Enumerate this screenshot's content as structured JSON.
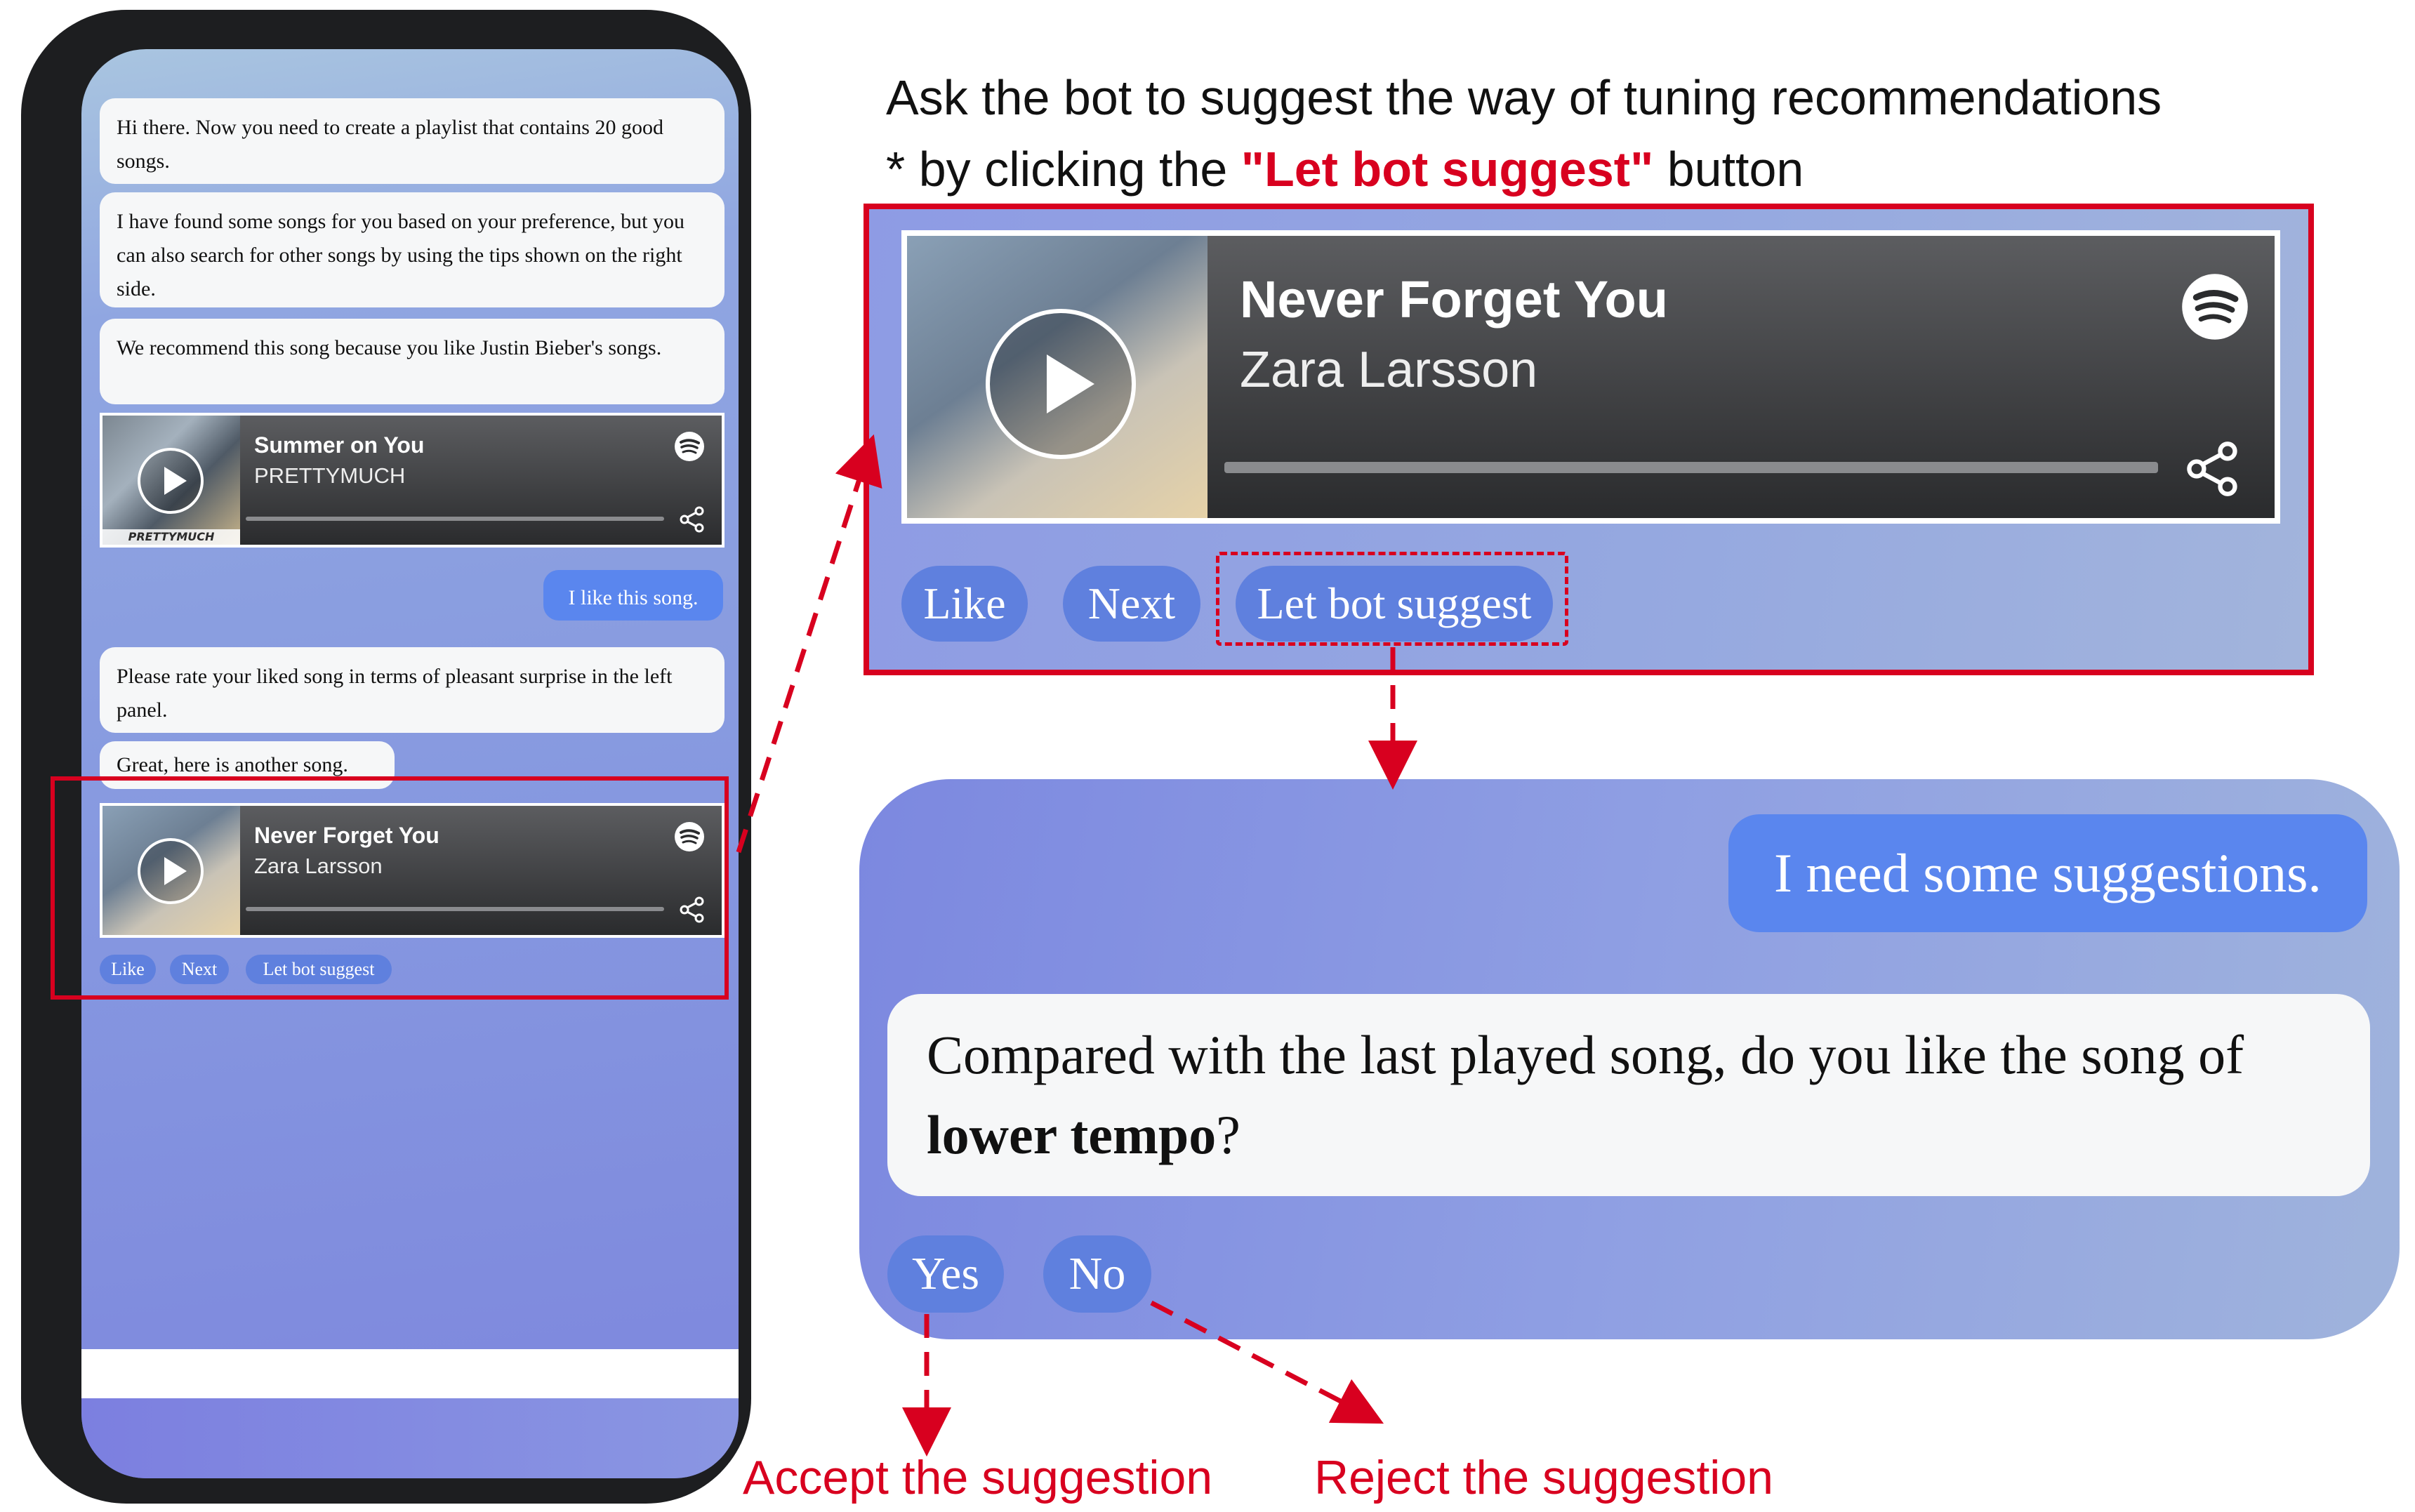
{
  "heading": {
    "line1": "Ask the bot to suggest the way of tuning recommendations",
    "line2_prefix": "* by clicking the ",
    "line2_highlight": "\"Let bot suggest\"",
    "line2_suffix": " button"
  },
  "phone": {
    "messages": [
      "Hi there. Now you need to create a playlist that contains 20 good songs.",
      "I have found some songs for you based on your preference, but you can also search for other songs by using the tips shown on the right side.",
      "We recommend this song because you like Justin Bieber's songs."
    ],
    "card1": {
      "title": "Summer on You",
      "artist": "PRETTYMUCH",
      "album_text": "PRETTYMUCH"
    },
    "user_message": "I like this song.",
    "rate_message": "Please rate your liked song in terms of pleasant surprise in the left panel.",
    "another_message": "Great, here is another song.",
    "card2": {
      "title": "Never Forget You",
      "artist": "Zara Larsson"
    },
    "buttons": {
      "like": "Like",
      "next": "Next",
      "suggest": "Let bot suggest"
    }
  },
  "zoom": {
    "card": {
      "title": "Never Forget You",
      "artist": "Zara Larsson"
    },
    "buttons": {
      "like": "Like",
      "next": "Next",
      "suggest": "Let bot suggest"
    }
  },
  "chat": {
    "user_message": "I need some suggestions.",
    "bot_message_prefix": "Compared with the last played song, do you like the song of",
    "bot_message_bold": "lower tempo",
    "bot_message_suffix": "?",
    "yes": "Yes",
    "no": "No"
  },
  "captions": {
    "accept": "Accept the suggestion",
    "reject": "Reject the suggestion"
  },
  "colors": {
    "annotation_red": "#d8001f",
    "user_bubble": "#5a86ee",
    "pill_blue": "#5f80de"
  },
  "icons": [
    "spotify-icon",
    "share-icon",
    "play-icon"
  ]
}
